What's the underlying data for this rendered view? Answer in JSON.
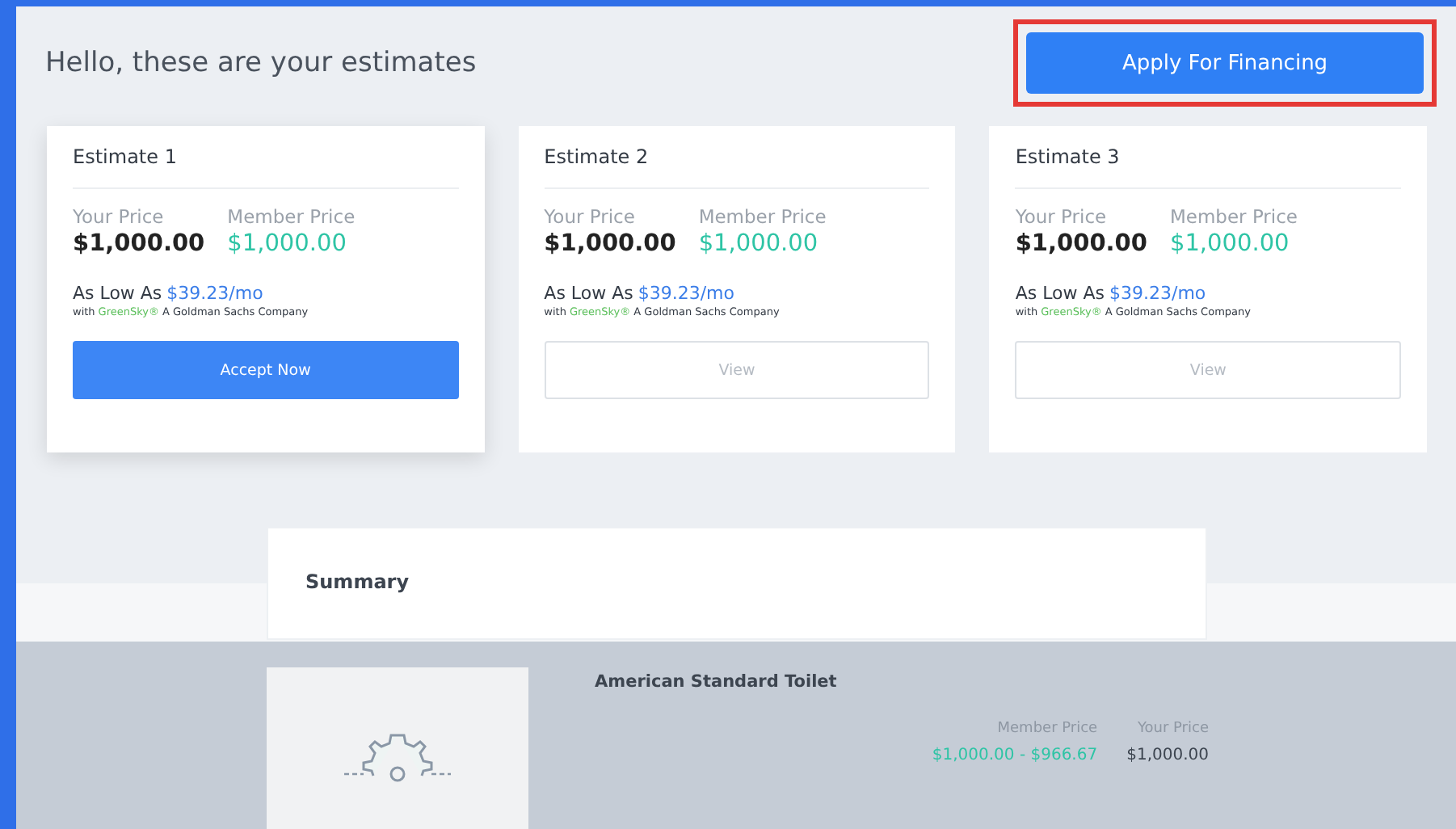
{
  "header": {
    "title": "Hello, these are your estimates",
    "apply_button": {
      "label": "Apply For Financing",
      "highlighted": true
    }
  },
  "estimates": [
    {
      "title": "Estimate 1",
      "your_price_label": "Your Price",
      "your_price": "$1,000.00",
      "member_price_label": "Member Price",
      "member_price": "$1,000.00",
      "as_low_as": "As Low As",
      "monthly": "$39.23/mo",
      "financing_with": "with",
      "lender": "GreenSky®",
      "lender_note": "A Goldman Sachs Company",
      "button": "Accept Now",
      "selected": true
    },
    {
      "title": "Estimate 2",
      "your_price_label": "Your Price",
      "your_price": "$1,000.00",
      "member_price_label": "Member Price",
      "member_price": "$1,000.00",
      "as_low_as": "As Low As",
      "monthly": "$39.23/mo",
      "financing_with": "with",
      "lender": "GreenSky®",
      "lender_note": "A Goldman Sachs Company",
      "button": "View",
      "selected": false
    },
    {
      "title": "Estimate 3",
      "your_price_label": "Your Price",
      "your_price": "$1,000.00",
      "member_price_label": "Member Price",
      "member_price": "$1,000.00",
      "as_low_as": "As Low As",
      "monthly": "$39.23/mo",
      "financing_with": "with",
      "lender": "GreenSky®",
      "lender_note": "A Goldman Sachs Company",
      "button": "View",
      "selected": false
    }
  ],
  "summary": {
    "title": "Summary"
  },
  "product": {
    "name": "American Standard Toilet",
    "member_price_label": "Member Price",
    "member_price": "$1,000.00 - $966.67",
    "your_price_label": "Your Price",
    "your_price": "$1,000.00"
  }
}
